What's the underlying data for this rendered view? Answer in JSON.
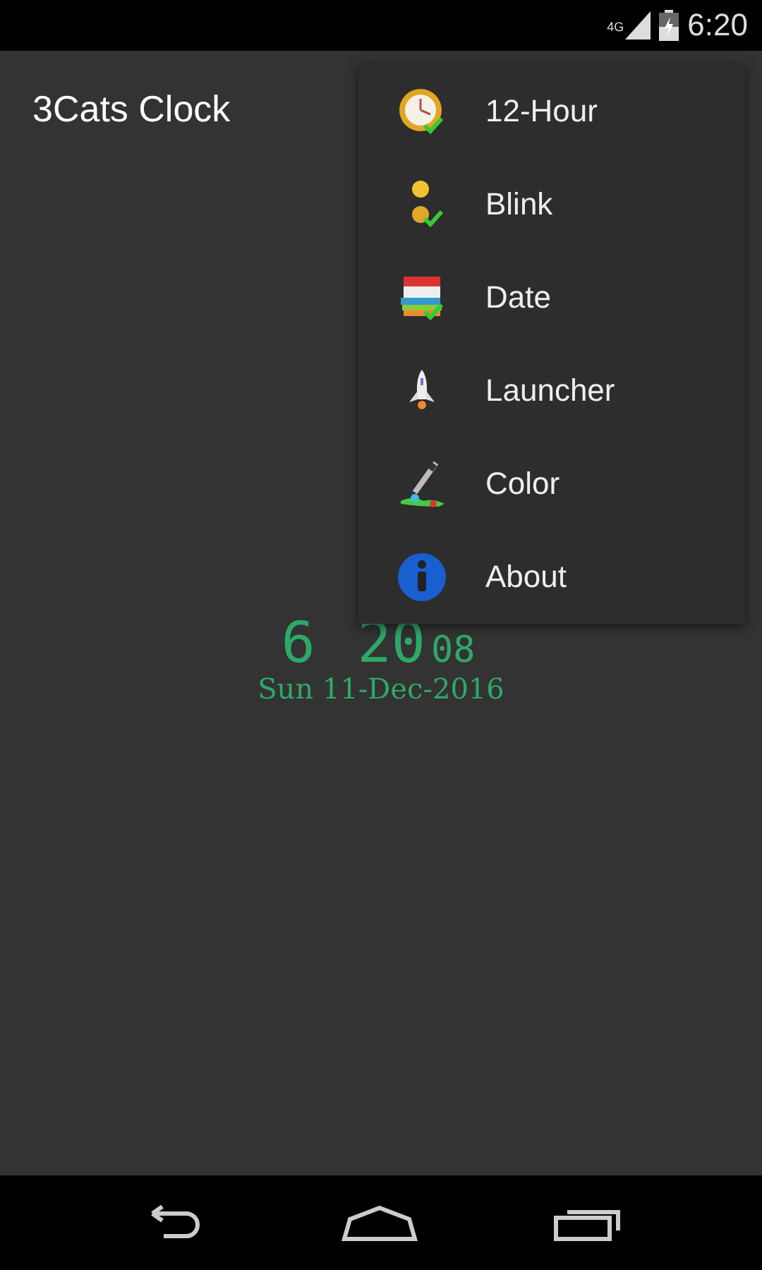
{
  "status_bar": {
    "network": "4G",
    "time": "6:20"
  },
  "action_bar": {
    "title": "3Cats Clock"
  },
  "clock": {
    "hours": "6",
    "minutes": "20",
    "seconds": "08",
    "date": "Sun 11-Dec-2016"
  },
  "menu": [
    {
      "kind": "clock",
      "label": "12-Hour"
    },
    {
      "kind": "blink",
      "label": "Blink"
    },
    {
      "kind": "calendar",
      "label": "Date"
    },
    {
      "kind": "rocket",
      "label": "Launcher"
    },
    {
      "kind": "dropper",
      "label": "Color"
    },
    {
      "kind": "info",
      "label": "About"
    }
  ]
}
